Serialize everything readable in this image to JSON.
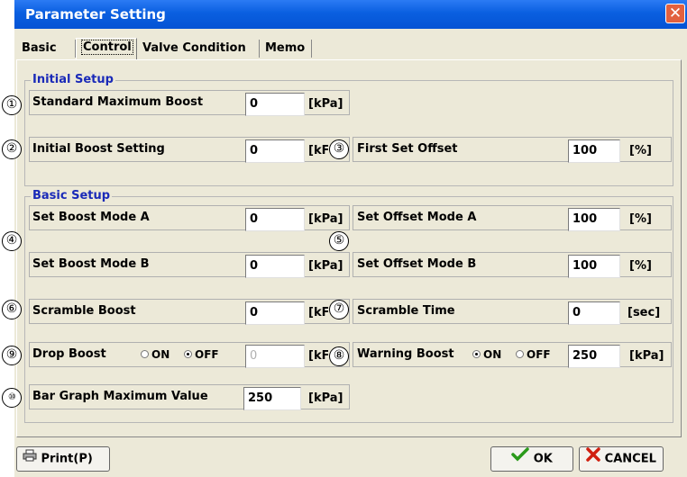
{
  "window": {
    "title": "Parameter Setting",
    "close_icon": "close-icon"
  },
  "tabs": [
    "Basic",
    "Control",
    "Valve Condition",
    "Memo"
  ],
  "active_tab": "Control",
  "groups": {
    "initial": "Initial Setup",
    "basic": "Basic Setup"
  },
  "fields": {
    "std_max_boost": {
      "label": "Standard Maximum Boost",
      "value": "0",
      "unit": "[kPa]",
      "marker": "①"
    },
    "initial_boost": {
      "label": "Initial Boost Setting",
      "value": "0",
      "unit": "[kF",
      "marker": "②"
    },
    "first_set_offset": {
      "label": "First Set Offset",
      "value": "100",
      "unit": "[%]",
      "marker": "③"
    },
    "set_boost_a": {
      "label": "Set Boost Mode A",
      "value": "0",
      "unit": "[kPa]"
    },
    "set_boost_b": {
      "label": "Set Boost Mode B",
      "value": "0",
      "unit": "[kPa]"
    },
    "boost_marker": "④",
    "set_offset_a": {
      "label": "Set Offset Mode A",
      "value": "100",
      "unit": "[%]"
    },
    "set_offset_b": {
      "label": "Set Offset Mode B",
      "value": "100",
      "unit": "[%]"
    },
    "offset_marker": "⑤",
    "scramble_boost": {
      "label": "Scramble Boost",
      "value": "0",
      "unit": "[kF",
      "marker": "⑥"
    },
    "scramble_time": {
      "label": "Scramble Time",
      "value": "0",
      "unit": "[sec]",
      "marker": "⑦"
    },
    "drop_boost": {
      "label": "Drop Boost",
      "value": "0",
      "unit": "[kF",
      "marker": "⑨",
      "on_label": "ON",
      "off_label": "OFF",
      "selected": "OFF"
    },
    "warning_boost": {
      "label": "Warning Boost",
      "value": "250",
      "unit": "[kPa]",
      "marker": "⑧",
      "on_label": "ON",
      "off_label": "OFF",
      "selected": "ON"
    },
    "bar_graph_max": {
      "label": "Bar Graph Maximum Value",
      "value": "250",
      "unit": "[kPa]",
      "marker": "⑩"
    }
  },
  "buttons": {
    "print": "Print(P)",
    "ok": "OK",
    "cancel": "CANCEL"
  },
  "colors": {
    "titlebar": "#0553d4",
    "group_title": "#1a2ab8",
    "ok_check": "#2a9a1a",
    "cancel_x": "#d02010"
  }
}
